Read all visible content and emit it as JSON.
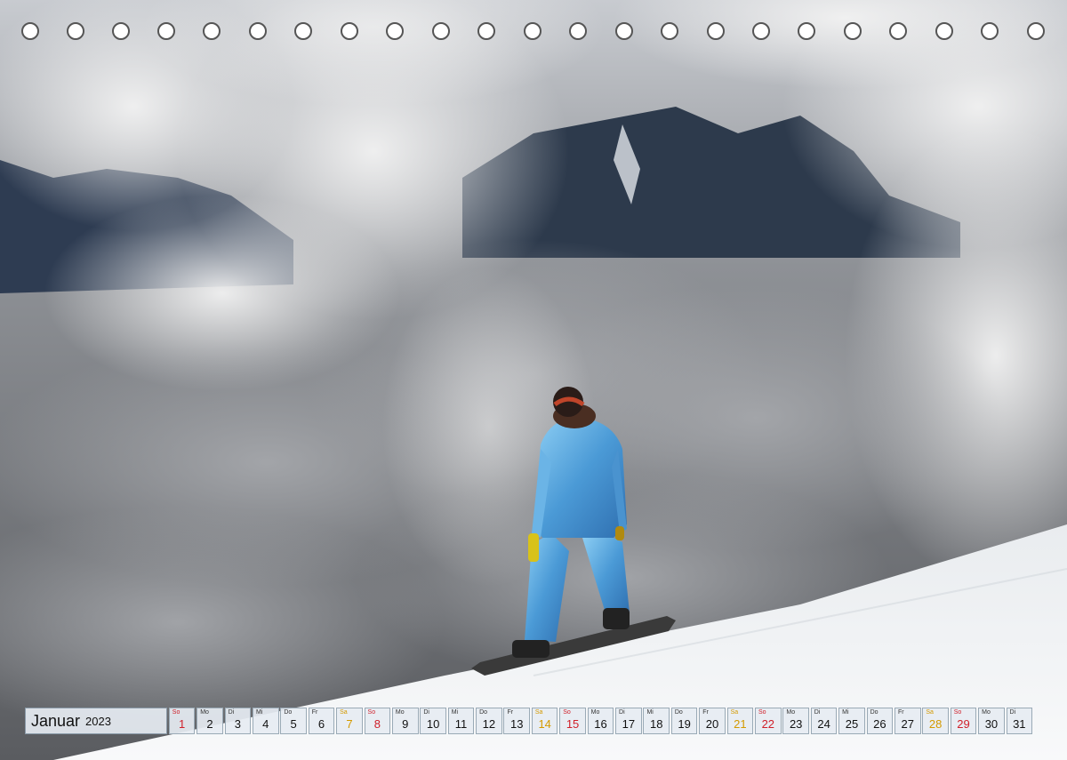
{
  "calendar": {
    "month": "Januar",
    "year": "2023",
    "days": [
      {
        "wd": "So",
        "num": "1",
        "type": "sun"
      },
      {
        "wd": "Mo",
        "num": "2",
        "type": "wk"
      },
      {
        "wd": "Di",
        "num": "3",
        "type": "wk"
      },
      {
        "wd": "Mi",
        "num": "4",
        "type": "wk"
      },
      {
        "wd": "Do",
        "num": "5",
        "type": "wk"
      },
      {
        "wd": "Fr",
        "num": "6",
        "type": "wk"
      },
      {
        "wd": "Sa",
        "num": "7",
        "type": "sat"
      },
      {
        "wd": "So",
        "num": "8",
        "type": "sun"
      },
      {
        "wd": "Mo",
        "num": "9",
        "type": "wk"
      },
      {
        "wd": "Di",
        "num": "10",
        "type": "wk"
      },
      {
        "wd": "Mi",
        "num": "11",
        "type": "wk"
      },
      {
        "wd": "Do",
        "num": "12",
        "type": "wk"
      },
      {
        "wd": "Fr",
        "num": "13",
        "type": "wk"
      },
      {
        "wd": "Sa",
        "num": "14",
        "type": "sat"
      },
      {
        "wd": "So",
        "num": "15",
        "type": "sun"
      },
      {
        "wd": "Mo",
        "num": "16",
        "type": "wk"
      },
      {
        "wd": "Di",
        "num": "17",
        "type": "wk"
      },
      {
        "wd": "Mi",
        "num": "18",
        "type": "wk"
      },
      {
        "wd": "Do",
        "num": "19",
        "type": "wk"
      },
      {
        "wd": "Fr",
        "num": "20",
        "type": "wk"
      },
      {
        "wd": "Sa",
        "num": "21",
        "type": "sat"
      },
      {
        "wd": "So",
        "num": "22",
        "type": "sun"
      },
      {
        "wd": "Mo",
        "num": "23",
        "type": "wk"
      },
      {
        "wd": "Di",
        "num": "24",
        "type": "wk"
      },
      {
        "wd": "Mi",
        "num": "25",
        "type": "wk"
      },
      {
        "wd": "Do",
        "num": "26",
        "type": "wk"
      },
      {
        "wd": "Fr",
        "num": "27",
        "type": "wk"
      },
      {
        "wd": "Sa",
        "num": "28",
        "type": "sat"
      },
      {
        "wd": "So",
        "num": "29",
        "type": "sun"
      },
      {
        "wd": "Mo",
        "num": "30",
        "type": "wk"
      },
      {
        "wd": "Di",
        "num": "31",
        "type": "wk"
      }
    ]
  },
  "colors": {
    "sunday": "#d0202a",
    "saturday": "#d49a00",
    "snowsuit": "#5fa8e0",
    "snow": "#f4f6f8",
    "cloud": "#8d8f93"
  },
  "scene": {
    "icons": [
      "binding-hole-icon",
      "snowboarder",
      "mountain",
      "clouds"
    ]
  }
}
